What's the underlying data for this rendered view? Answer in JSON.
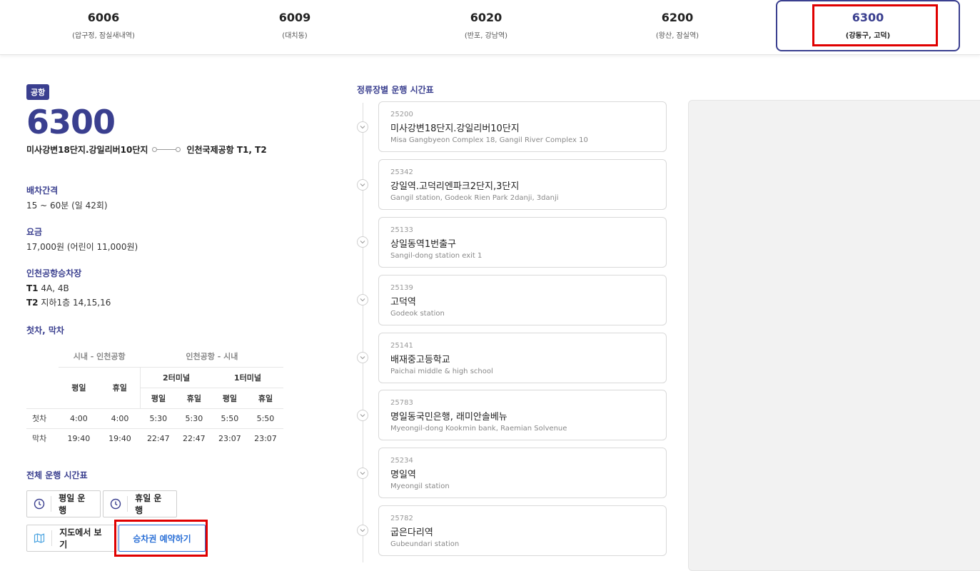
{
  "route_tabs": [
    {
      "number": "6006",
      "desc": "(압구정, 잠실새내역)"
    },
    {
      "number": "6009",
      "desc": "(대치동)"
    },
    {
      "number": "6020",
      "desc": "(반포, 강남역)"
    },
    {
      "number": "6200",
      "desc": "(왕산, 잠실역)"
    },
    {
      "number": "6300",
      "desc": "(강동구, 고덕)"
    }
  ],
  "active_tab_index": 4,
  "route": {
    "badge": "공항",
    "number": "6300",
    "origin": "미사강변18단지.강일리버10단지",
    "destination": "인천국제공항 T1, T2"
  },
  "interval": {
    "title": "배차간격",
    "value": "15 ~ 60분 (일 42회)"
  },
  "fare": {
    "title": "요금",
    "value": "17,000원 (어린이 11,000원)"
  },
  "boarding": {
    "title": "인천공항승차장",
    "t1_label": "T1",
    "t1_value": "4A, 4B",
    "t2_label": "T2",
    "t2_value": "지하1층 14,15,16"
  },
  "first_last": {
    "title": "첫차, 막차",
    "group_city": "시내 - 인천공항",
    "group_airport": "인천공항 - 시내",
    "terminal2": "2터미널",
    "terminal1": "1터미널",
    "weekday": "평일",
    "holiday": "휴일",
    "rows": [
      {
        "label": "첫차",
        "values": [
          "4:00",
          "4:00",
          "5:30",
          "5:30",
          "5:50",
          "5:50"
        ]
      },
      {
        "label": "막차",
        "values": [
          "19:40",
          "19:40",
          "22:47",
          "22:47",
          "23:07",
          "23:07"
        ]
      }
    ]
  },
  "schedule": {
    "title": "전체 운행 시간표",
    "weekday_btn": "평일 운행",
    "holiday_btn": "휴일 운행",
    "map_btn": "지도에서 보기",
    "reserve_btn": "승차권 예약하기"
  },
  "stops_title": "정류장별 운행 시간표",
  "stops": [
    {
      "code": "25200",
      "name": "미사강변18단지.강일리버10단지",
      "en": "Misa Gangbyeon Complex 18, Gangil River Complex 10"
    },
    {
      "code": "25342",
      "name": "강일역.고덕리엔파크2단지,3단지",
      "en": "Gangil station, Godeok Rien Park 2danji, 3danji"
    },
    {
      "code": "25133",
      "name": "상일동역1번출구",
      "en": "Sangil-dong station exit 1"
    },
    {
      "code": "25139",
      "name": "고덕역",
      "en": "Godeok station"
    },
    {
      "code": "25141",
      "name": "배재중고등학교",
      "en": "Paichai middle & high school"
    },
    {
      "code": "25783",
      "name": "명일동국민은행, 래미안솔베뉴",
      "en": "Myeongil-dong Kookmin bank, Raemian Solvenue"
    },
    {
      "code": "25234",
      "name": "명일역",
      "en": "Myeongil station"
    },
    {
      "code": "25782",
      "name": "굽은다리역",
      "en": "Gubeundari station"
    }
  ]
}
